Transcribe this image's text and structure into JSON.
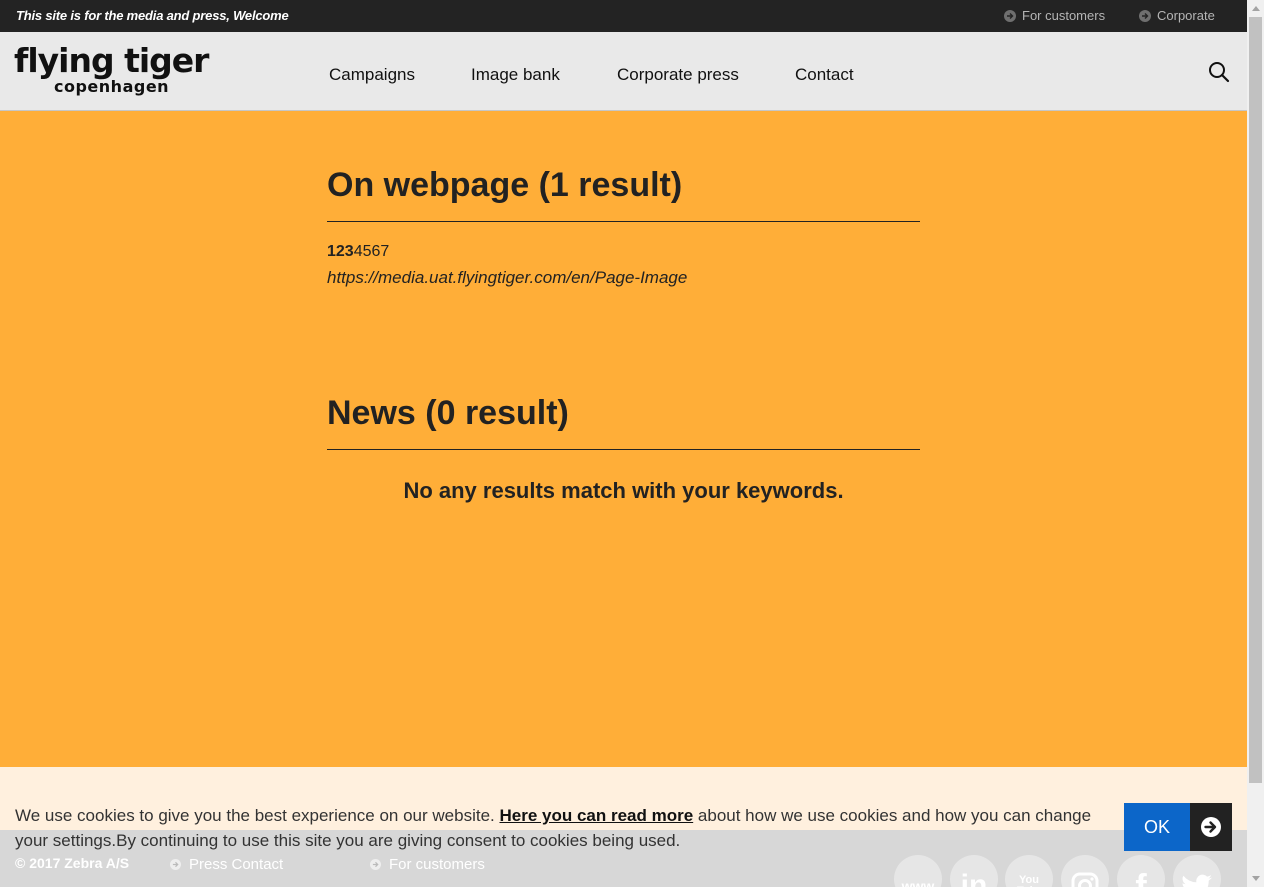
{
  "topbar": {
    "message": "This site is for the media and press, Welcome",
    "links": [
      {
        "label": "For customers",
        "icon": "arrow-circle-icon"
      },
      {
        "label": "Corporate",
        "icon": "arrow-circle-icon"
      }
    ]
  },
  "header": {
    "logo_main": "flying tiger",
    "logo_sub": "copenhagen",
    "nav": [
      "Campaigns",
      "Image bank",
      "Corporate press",
      "Contact"
    ],
    "search_icon": "search-icon"
  },
  "main": {
    "webpage_section": {
      "title": "On webpage (1 result)",
      "result": {
        "title_bold": "123",
        "title_rest": "4567",
        "url": "https://media.uat.flyingtiger.com/en/Page-Image"
      }
    },
    "news_section": {
      "title": "News (0 result)",
      "empty_message": "No any results match with your keywords."
    }
  },
  "footer": {
    "copyright": "© 2017 Zebra A/S",
    "links": [
      "Press Contact",
      "For customers"
    ],
    "social": [
      {
        "name": "website",
        "glyph": "www"
      },
      {
        "name": "linkedin",
        "glyph": "in"
      },
      {
        "name": "youtube",
        "glyph": "You Tube"
      },
      {
        "name": "instagram",
        "glyph": ""
      },
      {
        "name": "facebook",
        "glyph": "f"
      },
      {
        "name": "twitter",
        "glyph": ""
      }
    ]
  },
  "cookie": {
    "text_before": "We use cookies to give you the best experience on our website.",
    "link": "Here you can read more",
    "text_after": "about how we use cookies and how you can change your settings.By continuing to use this site you are giving consent to cookies being used.",
    "ok": "OK"
  },
  "colors": {
    "accent_orange": "#ffae38",
    "topbar": "#232323",
    "header_bg": "#e9e9e9",
    "ok_blue": "#0c66c9"
  }
}
